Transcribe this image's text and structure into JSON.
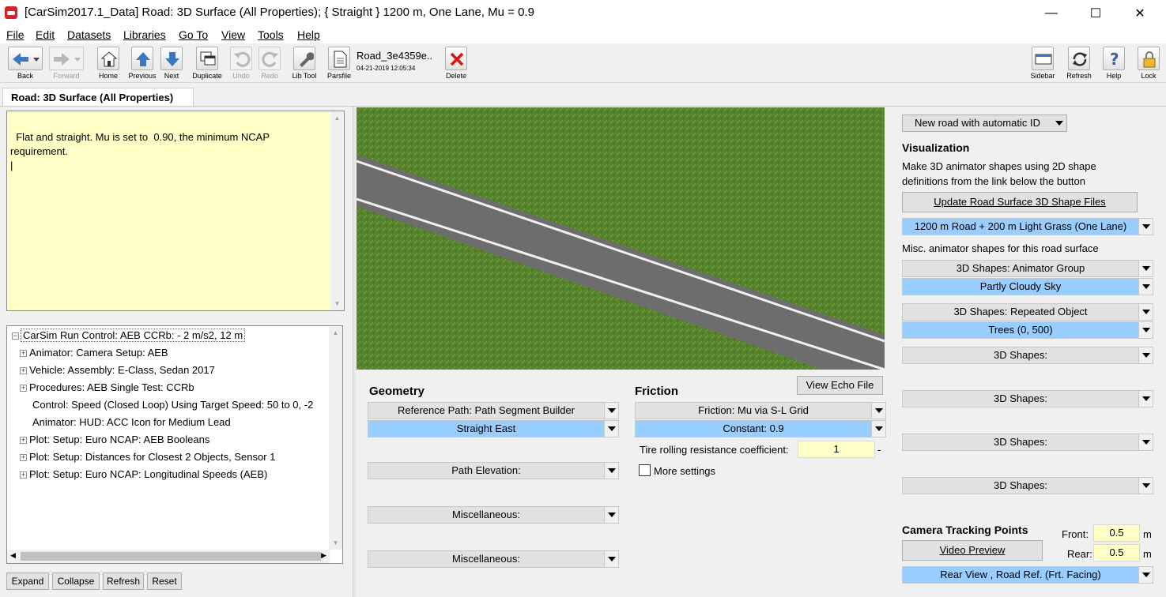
{
  "window": {
    "title": "[CarSim2017.1_Data] Road: 3D Surface (All Properties); { Straight } 1200 m, One Lane, Mu = 0.9",
    "minimize": "—",
    "maximize": "☐",
    "close": "✕"
  },
  "menu": [
    "File",
    "Edit",
    "Datasets",
    "Libraries",
    "Go To",
    "View",
    "Tools",
    "Help"
  ],
  "toolbar": {
    "back": "Back",
    "forward": "Forward",
    "home": "Home",
    "previous": "Previous",
    "next": "Next",
    "duplicate": "Duplicate",
    "undo": "Undo",
    "redo": "Redo",
    "lib_tool": "Lib Tool",
    "parsfile": "Parsfile",
    "parsfile_name": "Road_3e4359e..",
    "parsfile_date": "04-21-2019 12:05:34",
    "delete": "Delete",
    "sidebar": "Sidebar",
    "refresh": "Refresh",
    "help": "Help",
    "lock": "Lock"
  },
  "tab": {
    "label": "Road: 3D Surface (All Properties)"
  },
  "notes": {
    "text": "Flat and straight. Mu is set to  0.90, the minimum NCAP\nrequirement.\n|"
  },
  "tree": {
    "root": "CarSim Run Control: AEB  CCRb: - 2 m/s2, 12 m",
    "items": [
      {
        "label": "Animator: Camera Setup: AEB",
        "expandable": true
      },
      {
        "label": "Vehicle: Assembly: E-Class, Sedan 2017",
        "expandable": true
      },
      {
        "label": "Procedures: AEB Single Test: CCRb",
        "expandable": true
      },
      {
        "label": "Control: Speed (Closed Loop) Using Target Speed: 50 to 0, -2",
        "expandable": false
      },
      {
        "label": "Animator: HUD: ACC Icon for Medium Lead",
        "expandable": false
      },
      {
        "label": "Plot: Setup: Euro NCAP: AEB Booleans",
        "expandable": true
      },
      {
        "label": "Plot: Setup: Distances for Closest 2 Objects, Sensor 1",
        "expandable": true
      },
      {
        "label": "Plot: Setup: Euro NCAP: Longitudinal Speeds (AEB)",
        "expandable": true
      }
    ],
    "buttons": {
      "expand": "Expand",
      "collapse": "Collapse",
      "refresh": "Refresh",
      "reset": "Reset"
    }
  },
  "geometry": {
    "heading": "Geometry",
    "reference_path": "Reference Path: Path Segment Builder",
    "reference_path_value": "Straight East",
    "path_elevation": "Path Elevation:",
    "misc1": "Miscellaneous:",
    "misc2": "Miscellaneous:"
  },
  "friction": {
    "heading": "Friction",
    "view_echo": "View Echo File",
    "friction_type": "Friction: Mu via S-L Grid",
    "friction_value": "Constant: 0.9",
    "rolling_label": "Tire rolling resistance coefficient:",
    "rolling_value": "1",
    "rolling_unit": "-",
    "more_settings": "More settings"
  },
  "right": {
    "new_road": "New road with automatic ID",
    "viz_heading": "Visualization",
    "viz_desc": "Make 3D animator shapes using 2D shape\ndefinitions from the link below the button",
    "update_btn": "Update Road Surface 3D Shape Files",
    "surface_shape": "1200 m Road + 200 m Light Grass (One Lane)",
    "misc_label": "Misc. animator shapes for this road surface",
    "shape1": "3D Shapes: Animator Group",
    "shape1_value": "Partly Cloudy Sky",
    "shape2": "3D Shapes: Repeated Object",
    "shape2_value": "Trees (0, 500)",
    "shape3": "3D Shapes:",
    "shape4": "3D Shapes:",
    "shape5": "3D Shapes:",
    "shape6": "3D Shapes:",
    "camera_heading": "Camera Tracking Points",
    "front_label": "Front:",
    "front_value": "0.5",
    "rear_label": "Rear:",
    "rear_value": "0.5",
    "unit_m": "m",
    "video_preview": "Video Preview",
    "camera_view": "Rear View , Road Ref. (Frt. Facing)"
  },
  "colors": {
    "notes_bg": "#ffffc8",
    "selected_dd": "#99ccff",
    "grass": "#4f7a2a",
    "road": "#6e6e6e"
  }
}
